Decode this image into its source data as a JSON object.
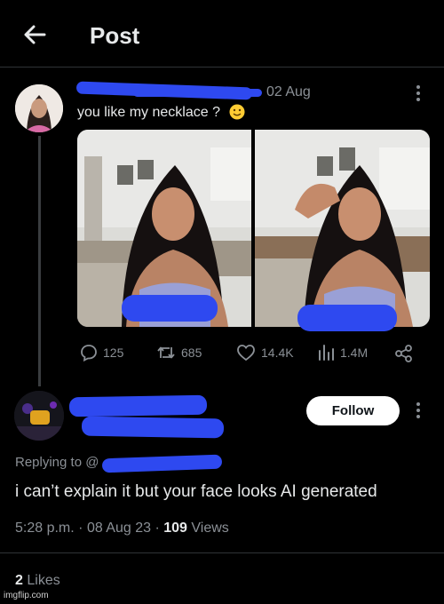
{
  "header": {
    "title": "Post"
  },
  "post": {
    "date": "02 Aug",
    "text": "you like my necklace ?",
    "stats": {
      "replies": "125",
      "reposts": "685",
      "likes": "14.4K",
      "views": "1.4M"
    }
  },
  "reply": {
    "follow_label": "Follow",
    "replying_to": "Replying to @",
    "text": "i can’t explain it but your face looks AI generated",
    "time": "5:28 p.m.",
    "date": "08 Aug 23",
    "views_count": "109",
    "views_label": "Views",
    "likes_count": "2",
    "likes_label": "Likes"
  },
  "watermark": "imgflip.com",
  "colors": {
    "redaction": "#2e49f0",
    "background": "#000000",
    "muted": "#8b9096"
  }
}
